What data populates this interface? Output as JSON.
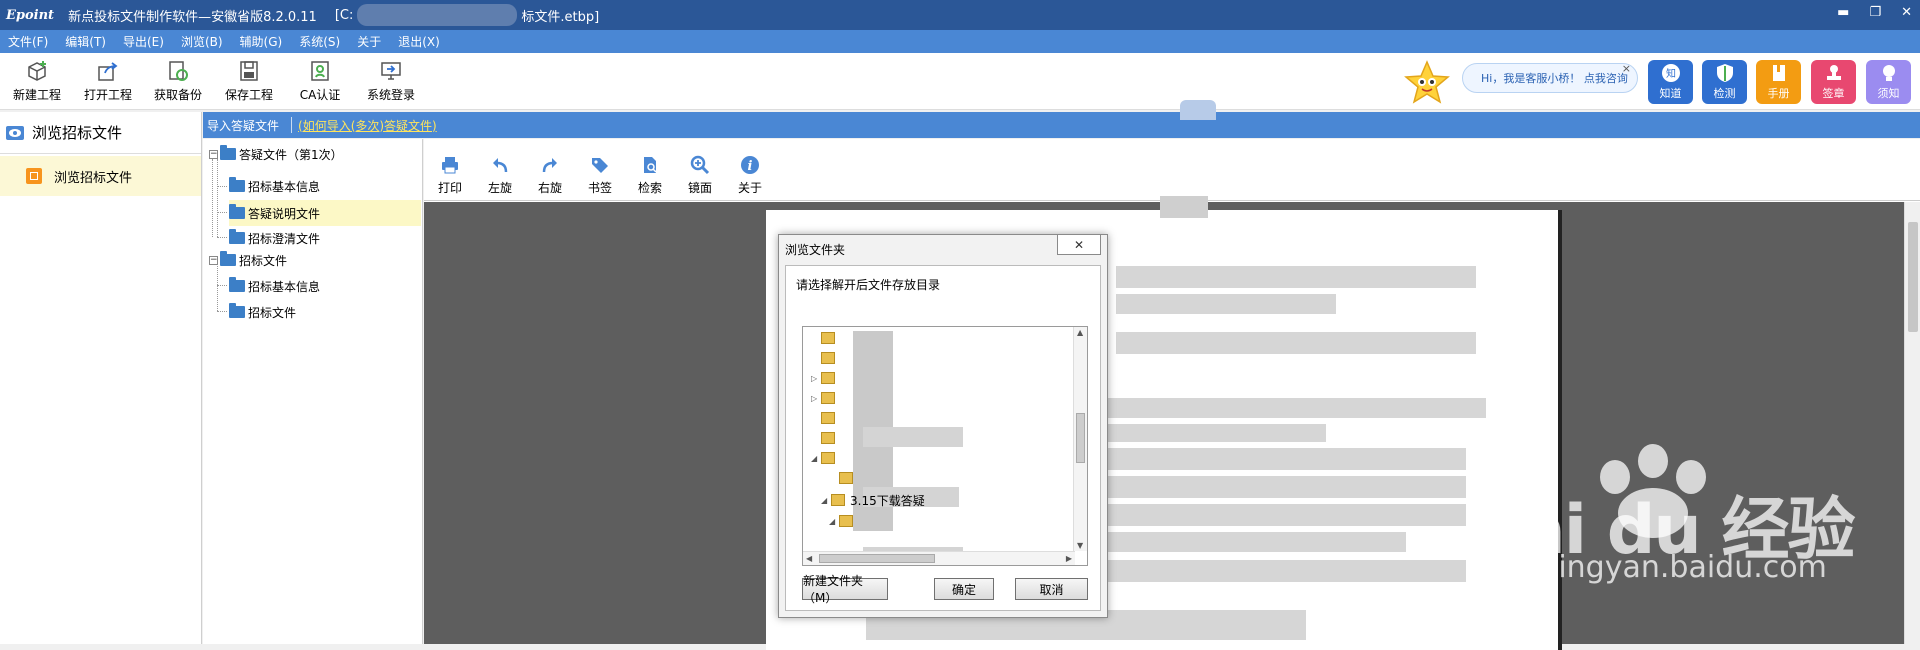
{
  "titlebar": {
    "logo": "Epoint",
    "title": "新点投标文件制作软件—安徽省版8.2.0.11",
    "path_start": "[C:",
    "path_end": "标文件.etbp]"
  },
  "menu": [
    "文件(F)",
    "编辑(T)",
    "导出(E)",
    "浏览(B)",
    "辅助(G)",
    "系统(S)",
    "关于",
    "退出(X)"
  ],
  "toolbar": [
    "新建工程",
    "打开工程",
    "获取备份",
    "保存工程",
    "CA认证",
    "系统登录"
  ],
  "chat": {
    "text": "Hi，我是客服小桥！ 点我咨询",
    "close": "×"
  },
  "right_buttons": [
    {
      "label": "知道",
      "color": "#2f6fd0"
    },
    {
      "label": "检测",
      "color": "#2f6fd0"
    },
    {
      "label": "手册",
      "color": "#f39c12"
    },
    {
      "label": "签章",
      "color": "#e84870"
    },
    {
      "label": "须知",
      "color": "#9b8cf0"
    }
  ],
  "left_panel": {
    "header": "浏览招标文件",
    "item": "浏览招标文件"
  },
  "subtabs": {
    "tab": "导入答疑文件",
    "link": "(如何导入(多次)答疑文件)"
  },
  "tree": {
    "n1": "答疑文件（第1次）",
    "n1a": "招标基本信息",
    "n1b": "答疑说明文件",
    "n1c": "招标澄清文件",
    "n2": "招标文件",
    "n2a": "招标基本信息",
    "n2b": "招标文件"
  },
  "viewer_tools": [
    "打印",
    "左旋",
    "右旋",
    "书签",
    "检索",
    "镜面",
    "关于"
  ],
  "dialog": {
    "title": "浏览文件夹",
    "close": "✕",
    "prompt": "请选择解开后文件存放目录",
    "visible_folder": "3.15下载答疑",
    "new_folder": "新建文件夹（M）",
    "ok": "确定",
    "cancel": "取消"
  },
  "watermark": {
    "brand": "Bai du 经验",
    "url": "jingyan.baidu.com"
  }
}
